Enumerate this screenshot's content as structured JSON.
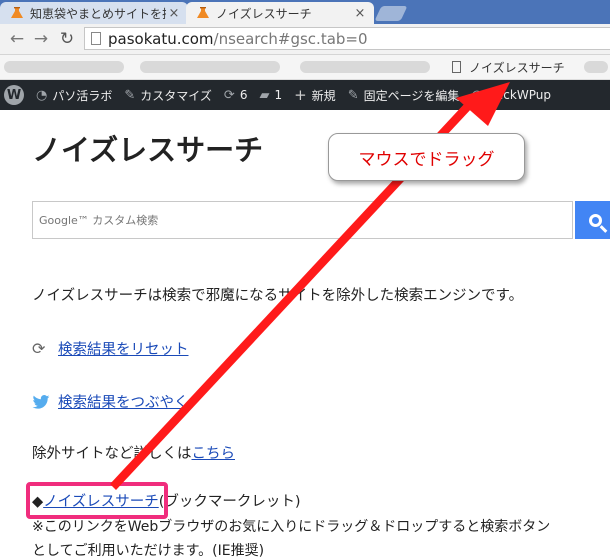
{
  "tabs": [
    {
      "title": "知恵袋やまとめサイトを排除",
      "close": "×"
    },
    {
      "title": "ノイズレスサーチ",
      "close": "×"
    }
  ],
  "address_bar": {
    "host": "pasokatu.com",
    "path": "/nsearch#gsc.tab=0"
  },
  "bookmarks_bar": {
    "item_label": "ノイズレスサーチ"
  },
  "admin_bar": {
    "site_label": "パソ活ラボ",
    "customize_label": "カスタマイズ",
    "updates_count": "6",
    "comments_count": "1",
    "new_label": "新規",
    "edit_label": "固定ページを編集",
    "backwpup_label": "BackWPup"
  },
  "page": {
    "title": "ノイズレスサーチ",
    "search_placeholder": "Google™ カスタム検索",
    "description": "ノイズレスサーチは検索で邪魔になるサイトを除外した検索エンジンです。",
    "reset_link": "検索結果をリセット",
    "tweet_link": "検索結果をつぶやく",
    "exclude_text": "除外サイトなど詳しくは",
    "exclude_link": "こちら",
    "bookmarklet_bullet": "◆",
    "bookmarklet_link": "ノイズレスサーチ",
    "bookmarklet_suffix": "(ブックマークレット)",
    "note": "※このリンクをWebブラウザのお気に入りにドラッグ＆ドロップすると検索ボタン",
    "note2": "としてご利用いただけます。(IE推奨)"
  },
  "annotation": {
    "callout": "マウスでドラッグ"
  },
  "colors": {
    "accent_pink": "#f02d7d",
    "arrow_red": "#ff1a1a",
    "search_blue": "#4285f4",
    "admin_bar": "#23282d"
  }
}
